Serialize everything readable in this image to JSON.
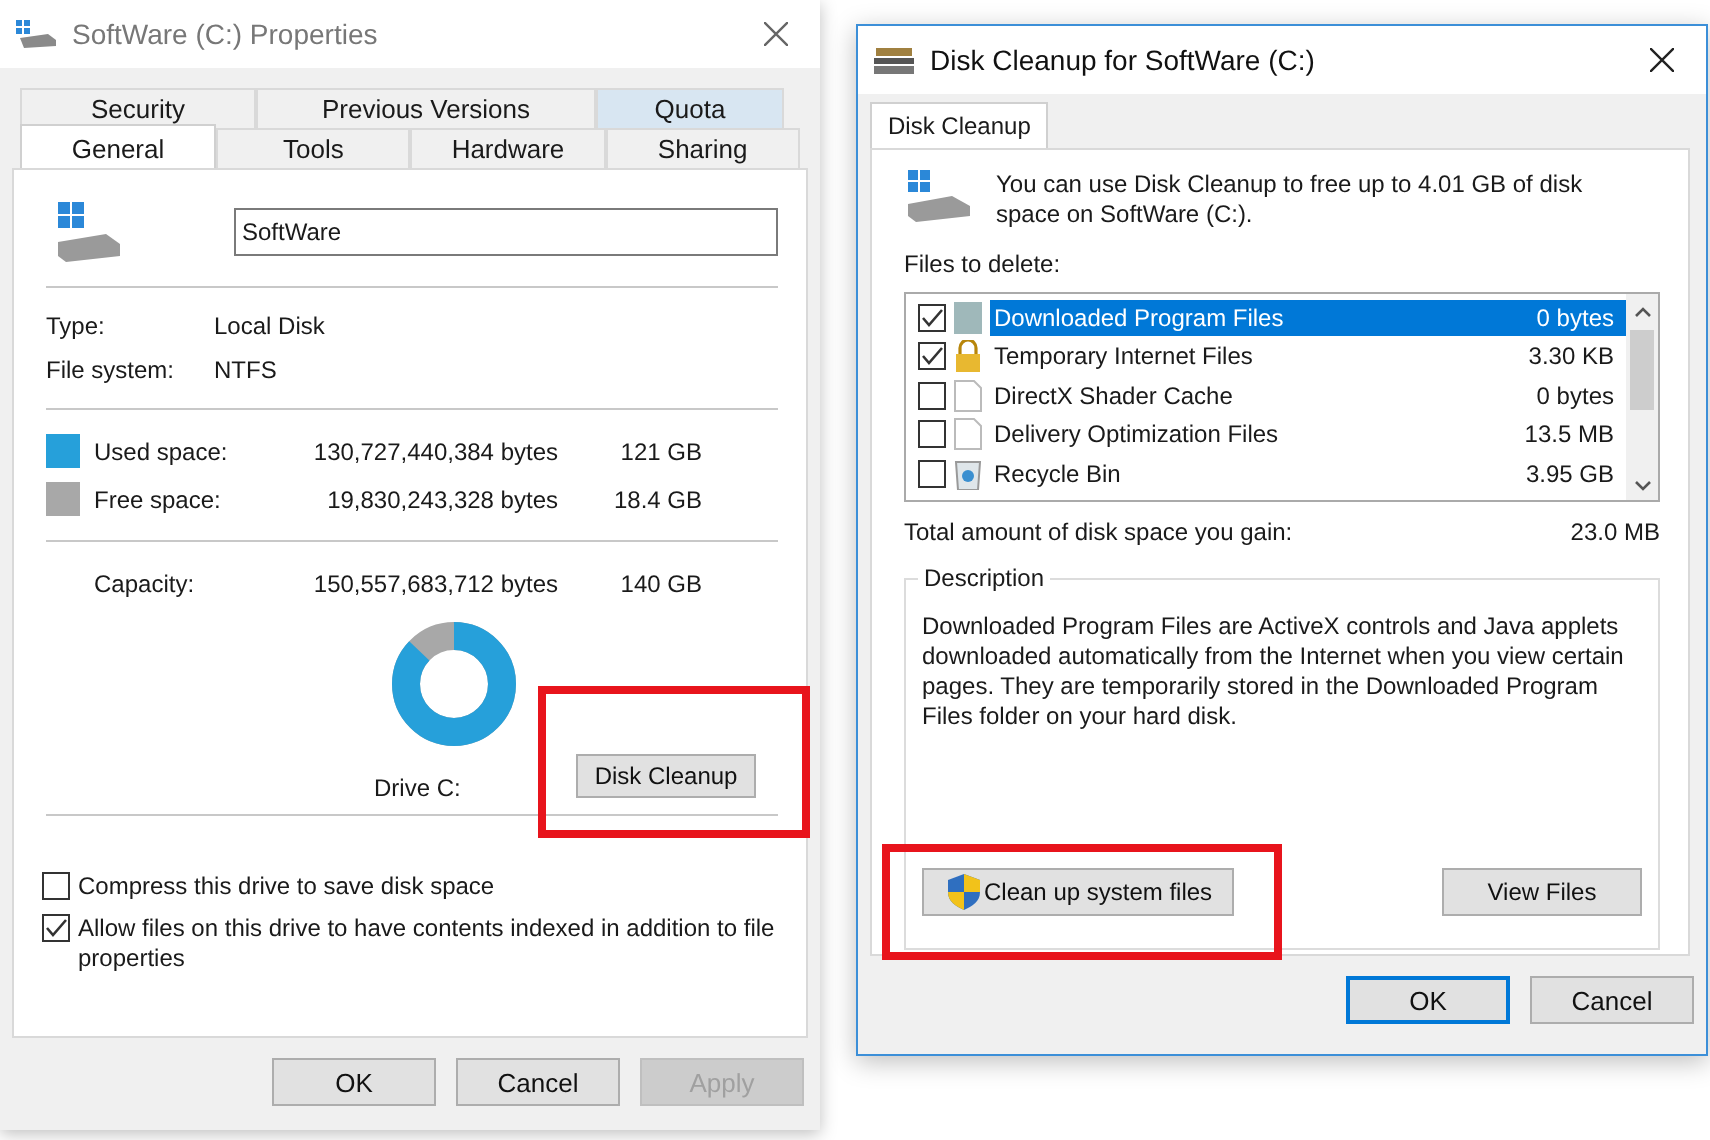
{
  "properties": {
    "title": "SoftWare (C:) Properties",
    "tab_rows": [
      [
        {
          "label": "Security",
          "selected": false,
          "highlighted": false
        },
        {
          "label": "Previous Versions",
          "selected": false,
          "highlighted": false
        },
        {
          "label": "Quota",
          "selected": false,
          "highlighted": true
        }
      ],
      [
        {
          "label": "General",
          "selected": true,
          "highlighted": false
        },
        {
          "label": "Tools",
          "selected": false,
          "highlighted": false
        },
        {
          "label": "Hardware",
          "selected": false,
          "highlighted": false
        },
        {
          "label": "Sharing",
          "selected": false,
          "highlighted": false
        }
      ]
    ],
    "name_field": "SoftWare",
    "info": [
      {
        "label": "Type:",
        "value": "Local Disk"
      },
      {
        "label": "File system:",
        "value": "NTFS"
      }
    ],
    "space": [
      {
        "kind": "used",
        "label": "Used space:",
        "bytes": "130,727,440,384 bytes",
        "size": "121 GB"
      },
      {
        "kind": "free",
        "label": "Free space:",
        "bytes": "19,830,243,328 bytes",
        "size": "18.4 GB"
      }
    ],
    "capacity": {
      "label": "Capacity:",
      "bytes": "150,557,683,712 bytes",
      "size": "140 GB"
    },
    "usage": {
      "level": 0.87
    },
    "drive_label": "Drive C:",
    "cleanup_button": "Disk Cleanup",
    "options": [
      {
        "label": "Compress this drive to save disk space",
        "checked": false
      },
      {
        "label": "Allow files on this drive to have contents indexed in addition to file properties",
        "checked": true
      }
    ],
    "buttons": [
      {
        "label": "OK",
        "disabled": false
      },
      {
        "label": "Cancel",
        "disabled": false
      },
      {
        "label": "Apply",
        "disabled": true
      }
    ]
  },
  "cleanup": {
    "title": "Disk Cleanup for SoftWare (C:)",
    "tab": "Disk Cleanup",
    "intro": "You can use Disk Cleanup to free up to 4.01 GB of disk space on SoftWare (C:).",
    "files_label": "Files to delete:",
    "files": [
      {
        "kind": "blank",
        "name": "Downloaded Program Files",
        "size": "0 bytes",
        "checked": true,
        "selected": true
      },
      {
        "kind": "lock",
        "name": "Temporary Internet Files",
        "size": "3.30 KB",
        "checked": true,
        "selected": false
      },
      {
        "kind": "page",
        "name": "DirectX Shader Cache",
        "size": "0 bytes",
        "checked": false,
        "selected": false
      },
      {
        "kind": "page",
        "name": "Delivery Optimization Files",
        "size": "13.5 MB",
        "checked": false,
        "selected": false
      },
      {
        "kind": "bin",
        "name": "Recycle Bin",
        "size": "3.95 GB",
        "checked": false,
        "selected": false
      }
    ],
    "total_label": "Total amount of disk space you gain:",
    "total": "23.0 MB",
    "description_title": "Description",
    "description": "Downloaded Program Files are ActiveX controls and Java applets downloaded automatically from the Internet when you view certain pages. They are temporarily stored in the Downloaded Program Files folder on your hard disk.",
    "system_button": "Clean up system files",
    "view_button": "View Files",
    "buttons": [
      {
        "label": "OK",
        "default": true
      },
      {
        "label": "Cancel",
        "default": false
      }
    ]
  }
}
